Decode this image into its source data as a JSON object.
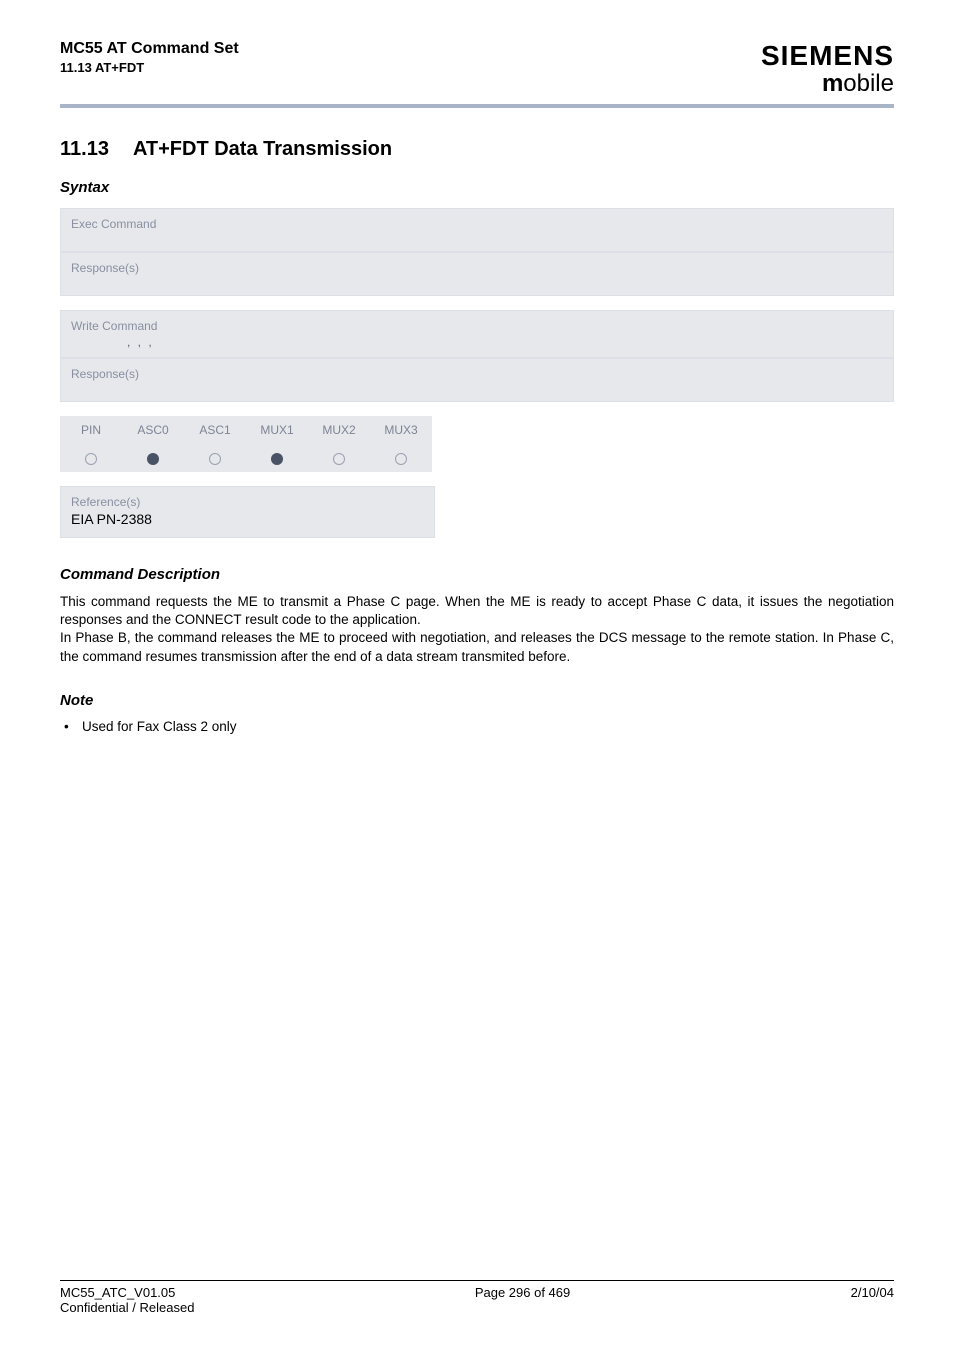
{
  "header": {
    "title": "MC55 AT Command Set",
    "subtitle": "11.13 AT+FDT",
    "brand": "SIEMENS",
    "brand_sub": "obile"
  },
  "heading": {
    "number": "11.13",
    "title": "AT+FDT   Data Transmission"
  },
  "syntax_label": "Syntax",
  "panels": {
    "exec_header": "Exec Command",
    "exec_body": "",
    "exec_response_header": "Response(s)",
    "exec_response_body": "",
    "write_header": "Write Command",
    "write_params": ",          ,          ,",
    "write_response_header": "Response(s)",
    "write_response_body": ""
  },
  "pin_table": {
    "cols": [
      "PIN",
      "ASC0",
      "ASC1",
      "MUX1",
      "MUX2",
      "MUX3"
    ],
    "dots": [
      "empty",
      "filled",
      "empty",
      "filled",
      "empty",
      "empty"
    ]
  },
  "reference": {
    "header": "Reference(s)",
    "body": "EIA PN-2388"
  },
  "cmd_desc_label": "Command Description",
  "cmd_desc_text": "This command requests the ME to transmit a Phase C page. When the ME is ready to accept Phase C data, it issues the negotiation responses and the CONNECT result code to the application.\nIn Phase B, the                command releases the ME to proceed with negotiation, and releases the DCS message to the remote station. In Phase C, the                  command resumes transmission after the end of a data stream transmited before.",
  "note_label": "Note",
  "note_item": "Used for Fax Class 2 only",
  "footer": {
    "left1": "MC55_ATC_V01.05",
    "left2": "Confidential / Released",
    "center": "Page 296 of 469",
    "right": "2/10/04"
  }
}
